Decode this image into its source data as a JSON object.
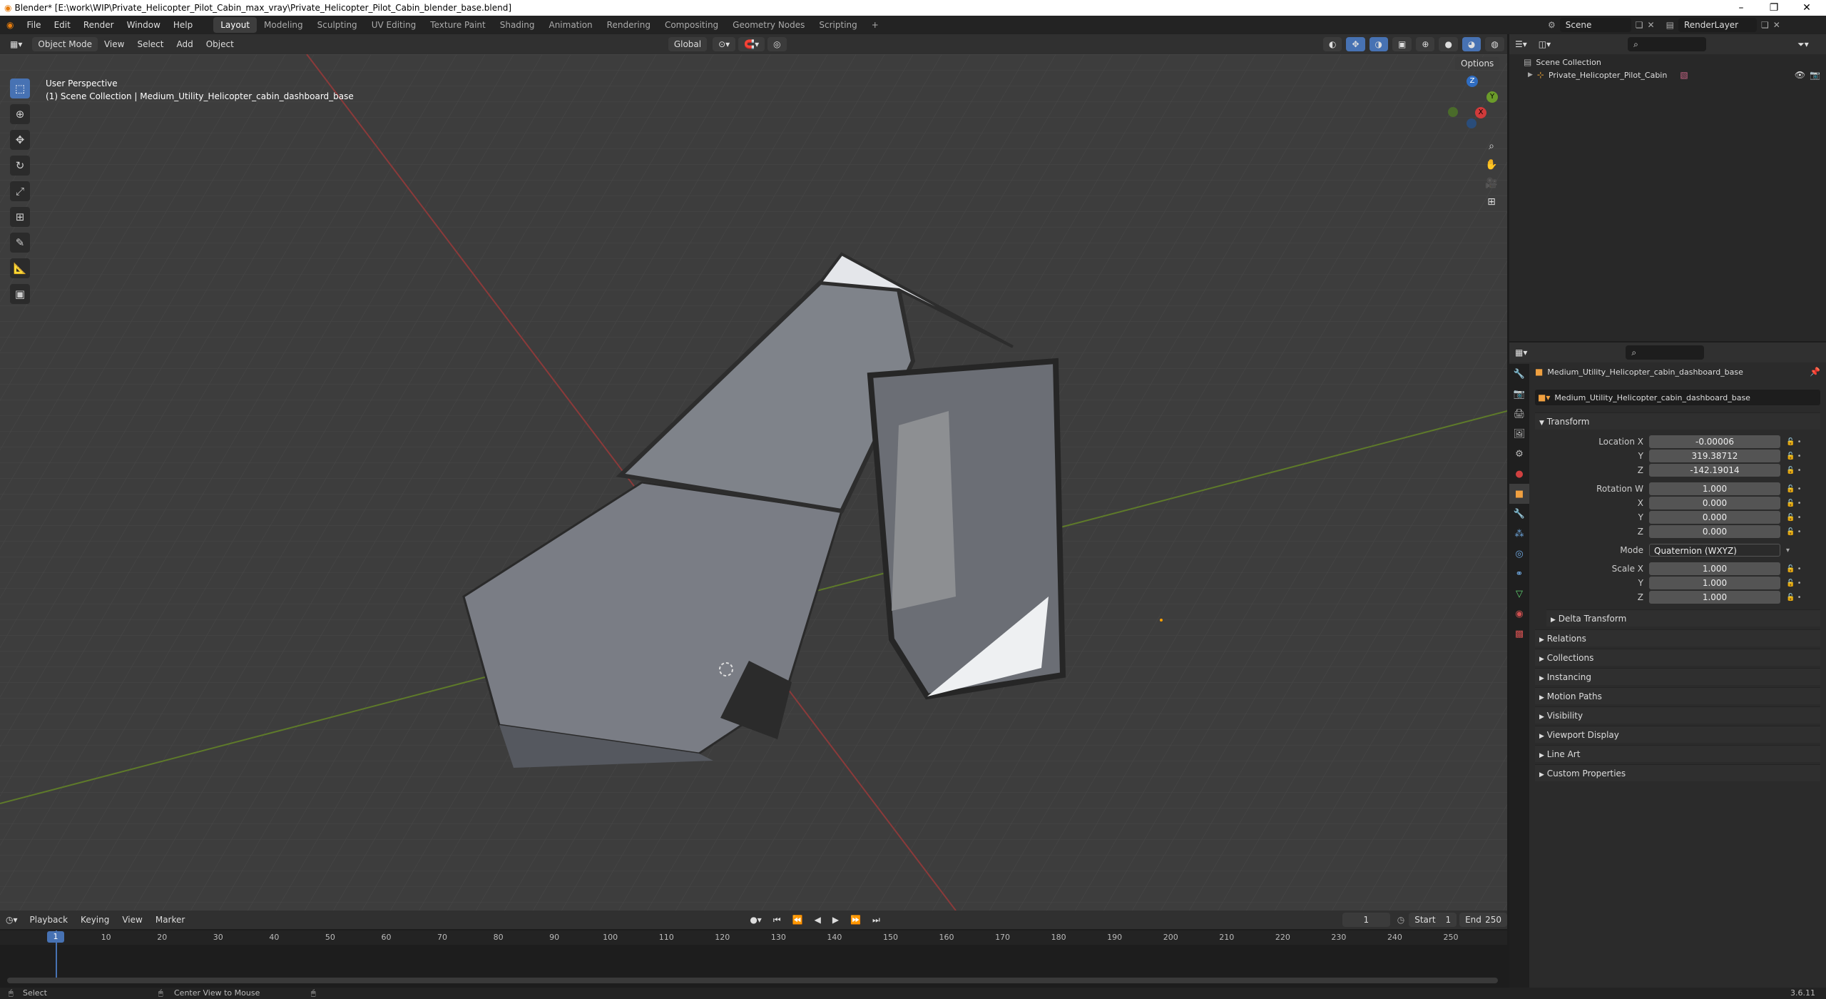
{
  "window": {
    "title": "Blender* [E:\\work\\WIP\\Private_Helicopter_Pilot_Cabin_max_vray\\Private_Helicopter_Pilot_Cabin_blender_base.blend]",
    "minimize": "–",
    "maximize": "❐",
    "close": "✕"
  },
  "menu": {
    "items": [
      "File",
      "Edit",
      "Render",
      "Window",
      "Help"
    ]
  },
  "workspaces": [
    "Layout",
    "Modeling",
    "Sculpting",
    "UV Editing",
    "Texture Paint",
    "Shading",
    "Animation",
    "Rendering",
    "Compositing",
    "Geometry Nodes",
    "Scripting"
  ],
  "add_workspace": "+",
  "scene": {
    "name": "Scene",
    "render_layer": "RenderLayer"
  },
  "viewport_header": {
    "mode": "Object Mode",
    "menus": [
      "View",
      "Select",
      "Add",
      "Object"
    ],
    "orientation": "Global",
    "options": "Options"
  },
  "viewport": {
    "perspective": "User Perspective",
    "collection_info": "(1) Scene Collection | Medium_Utility_Helicopter_cabin_dashboard_base"
  },
  "gizmo": {
    "z": "Z",
    "y": "Y",
    "x": "X"
  },
  "outliner": {
    "root": "Scene Collection",
    "item": "Private_Helicopter_Pilot_Cabin"
  },
  "properties": {
    "object_name": "Medium_Utility_Helicopter_cabin_dashboard_base",
    "data_name": "Medium_Utility_Helicopter_cabin_dashboard_base",
    "transform_label": "Transform",
    "location": {
      "label": "Location X",
      "x": "-0.00006",
      "y": "319.38712",
      "z": "-142.19014"
    },
    "rotation": {
      "label": "Rotation W",
      "w": "1.000",
      "x": "0.000",
      "y": "0.000",
      "z": "0.000"
    },
    "mode": {
      "label": "Mode",
      "value": "Quaternion (WXYZ)"
    },
    "scale": {
      "label": "Scale X",
      "x": "1.000",
      "y": "1.000",
      "z": "1.000"
    },
    "axis_labels": {
      "y": "Y",
      "z": "Z",
      "x": "X"
    },
    "delta": "Delta Transform",
    "panels": [
      "Relations",
      "Collections",
      "Instancing",
      "Motion Paths",
      "Visibility",
      "Viewport Display",
      "Line Art",
      "Custom Properties"
    ]
  },
  "timeline": {
    "menus": [
      "Playback",
      "Keying",
      "View",
      "Marker"
    ],
    "current_frame": "1",
    "start_label": "Start",
    "start": "1",
    "end_label": "End",
    "end": "250",
    "ticks": [
      "1",
      "10",
      "20",
      "30",
      "40",
      "50",
      "60",
      "70",
      "80",
      "90",
      "100",
      "110",
      "120",
      "130",
      "140",
      "150",
      "160",
      "170",
      "180",
      "190",
      "200",
      "210",
      "220",
      "230",
      "240",
      "250"
    ]
  },
  "status": {
    "select": "Select",
    "center": "Center View to Mouse",
    "version": "3.6.11"
  }
}
